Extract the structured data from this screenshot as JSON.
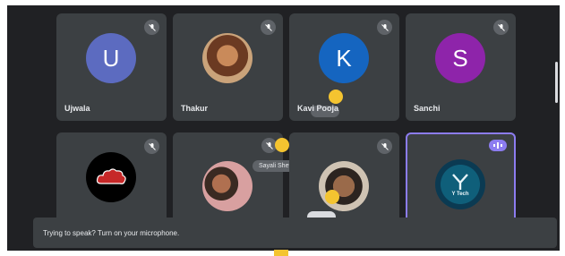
{
  "tiles": [
    {
      "name": "Ujwala",
      "initial": "U",
      "color": "#5c6bc0"
    },
    {
      "name": "Thakur"
    },
    {
      "name": "Kavi Pooja",
      "initial": "K",
      "color": "#1565c0"
    },
    {
      "name": "Sanchi",
      "initial": "S",
      "color": "#8e24aa"
    }
  ],
  "bottom_tiles": [
    {
      "label": "Sayali Shetty"
    },
    {},
    {
      "caption": "Y Tech"
    }
  ],
  "banner": {
    "text": "Trying to speak? Turn on your microphone."
  },
  "colors": {
    "background": "#202124",
    "tile": "#3c4043",
    "active_speaker": "#8c7cf0",
    "raised_hand": "#f4c430"
  }
}
